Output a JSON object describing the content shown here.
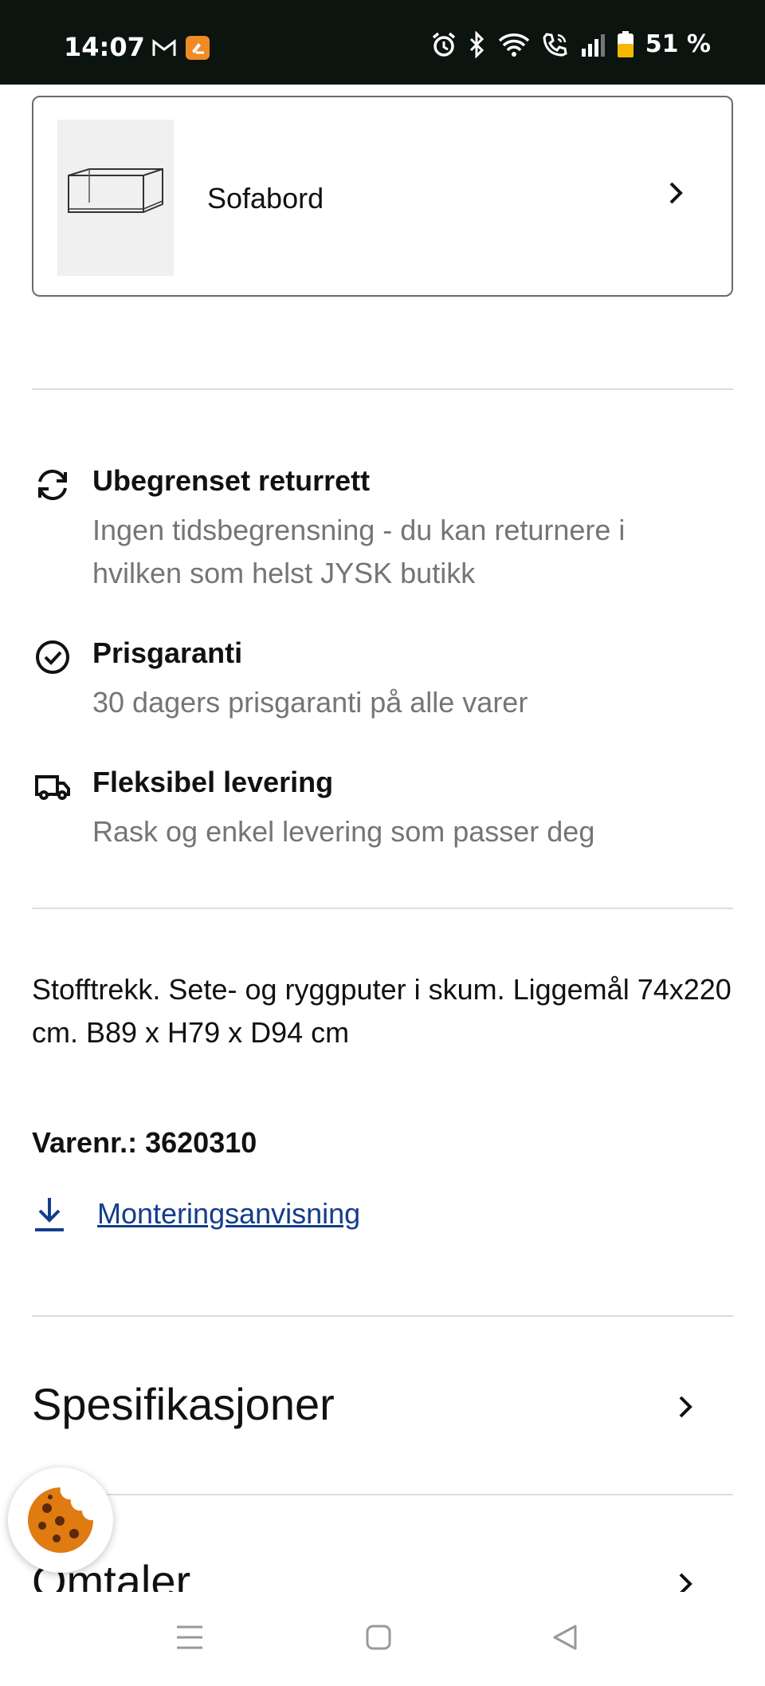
{
  "status_bar": {
    "time": "14:07",
    "left_icons": [
      "gmail-icon",
      "app-notification-icon"
    ],
    "right_icons": [
      "alarm-icon",
      "bluetooth-icon",
      "wifi-icon",
      "wifi-calling-icon",
      "signal-icon",
      "battery-icon"
    ],
    "battery": "51 %",
    "battery_color": "#f5b800"
  },
  "product_card": {
    "title": "Sofabord",
    "image": "coffee-table-image"
  },
  "usps": [
    {
      "icon": "refresh-icon",
      "title": "Ubegrenset returrett",
      "text": "Ingen tidsbegrensning - du kan returnere i hvilken som helst JYSK butikk"
    },
    {
      "icon": "check-circle-icon",
      "title": "Prisgaranti",
      "text": "30 dagers prisgaranti på alle varer"
    },
    {
      "icon": "truck-icon",
      "title": "Fleksibel levering",
      "text": "Rask og enkel levering som passer deg"
    }
  ],
  "description": "Stofftrekk. Sete- og ryggputer i skum. Liggemål 74x220 cm. B89 x H79 x D94 cm",
  "sku": {
    "label": "Varenr.:",
    "value": "3620310"
  },
  "download": {
    "label": "Monteringsanvisning",
    "link_color": "#143c8c"
  },
  "accordions": [
    {
      "title": "Spesifikasjoner"
    },
    {
      "title": "Omtaler"
    }
  ],
  "cookie_button": {
    "icon": "cookie-icon",
    "color": "#e07b12"
  },
  "nav_bar": {
    "items": [
      "recent-apps-icon",
      "home-icon",
      "back-icon"
    ]
  }
}
